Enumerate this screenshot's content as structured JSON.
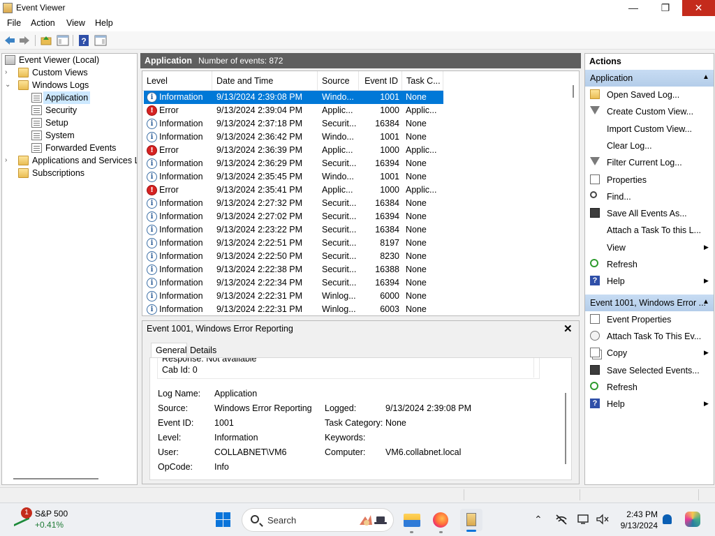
{
  "window": {
    "title": "Event Viewer",
    "controls": {
      "minimize": "—",
      "maximize": "❐",
      "close": "✕"
    }
  },
  "menu": [
    "File",
    "Action",
    "View",
    "Help"
  ],
  "tree": {
    "items": [
      {
        "label": "Event Viewer (Local)",
        "icon": "event-viewer-icon",
        "expander": ""
      },
      {
        "label": "Custom Views",
        "icon": "folder-icon",
        "expander": "›"
      },
      {
        "label": "Windows Logs",
        "icon": "folder-icon",
        "expander": "⌄"
      },
      {
        "label": "Application",
        "icon": "log-icon",
        "expander": ""
      },
      {
        "label": "Security",
        "icon": "log-icon",
        "expander": ""
      },
      {
        "label": "Setup",
        "icon": "log-icon",
        "expander": ""
      },
      {
        "label": "System",
        "icon": "log-icon",
        "expander": ""
      },
      {
        "label": "Forwarded Events",
        "icon": "log-icon",
        "expander": ""
      },
      {
        "label": "Applications and Services Lo",
        "icon": "folder-icon",
        "expander": "›"
      },
      {
        "label": "Subscriptions",
        "icon": "folder-icon",
        "expander": ""
      }
    ],
    "selected": "Application"
  },
  "center": {
    "title": "Application",
    "event_count": "Number of events: 872",
    "columns": [
      "Level",
      "Date and Time",
      "Source",
      "Event ID",
      "Task C..."
    ],
    "rows": [
      {
        "level": "Information",
        "datetime": "9/13/2024 2:39:08 PM",
        "source": "Windo...",
        "event_id": "1001",
        "task": "None"
      },
      {
        "level": "Error",
        "datetime": "9/13/2024 2:39:04 PM",
        "source": "Applic...",
        "event_id": "1000",
        "task": "Applic..."
      },
      {
        "level": "Information",
        "datetime": "9/13/2024 2:37:18 PM",
        "source": "Securit...",
        "event_id": "16384",
        "task": "None"
      },
      {
        "level": "Information",
        "datetime": "9/13/2024 2:36:42 PM",
        "source": "Windo...",
        "event_id": "1001",
        "task": "None"
      },
      {
        "level": "Error",
        "datetime": "9/13/2024 2:36:39 PM",
        "source": "Applic...",
        "event_id": "1000",
        "task": "Applic..."
      },
      {
        "level": "Information",
        "datetime": "9/13/2024 2:36:29 PM",
        "source": "Securit...",
        "event_id": "16394",
        "task": "None"
      },
      {
        "level": "Information",
        "datetime": "9/13/2024 2:35:45 PM",
        "source": "Windo...",
        "event_id": "1001",
        "task": "None"
      },
      {
        "level": "Error",
        "datetime": "9/13/2024 2:35:41 PM",
        "source": "Applic...",
        "event_id": "1000",
        "task": "Applic..."
      },
      {
        "level": "Information",
        "datetime": "9/13/2024 2:27:32 PM",
        "source": "Securit...",
        "event_id": "16384",
        "task": "None"
      },
      {
        "level": "Information",
        "datetime": "9/13/2024 2:27:02 PM",
        "source": "Securit...",
        "event_id": "16394",
        "task": "None"
      },
      {
        "level": "Information",
        "datetime": "9/13/2024 2:23:22 PM",
        "source": "Securit...",
        "event_id": "16384",
        "task": "None"
      },
      {
        "level": "Information",
        "datetime": "9/13/2024 2:22:51 PM",
        "source": "Securit...",
        "event_id": "8197",
        "task": "None"
      },
      {
        "level": "Information",
        "datetime": "9/13/2024 2:22:50 PM",
        "source": "Securit...",
        "event_id": "8230",
        "task": "None"
      },
      {
        "level": "Information",
        "datetime": "9/13/2024 2:22:38 PM",
        "source": "Securit...",
        "event_id": "16388",
        "task": "None"
      },
      {
        "level": "Information",
        "datetime": "9/13/2024 2:22:34 PM",
        "source": "Securit...",
        "event_id": "16394",
        "task": "None"
      },
      {
        "level": "Information",
        "datetime": "9/13/2024 2:22:31 PM",
        "source": "Winlog...",
        "event_id": "6000",
        "task": "None"
      },
      {
        "level": "Information",
        "datetime": "9/13/2024 2:22:31 PM",
        "source": "Winlog...",
        "event_id": "6003",
        "task": "None"
      }
    ],
    "selected_row": 0
  },
  "detail": {
    "title": "Event 1001, Windows Error Reporting",
    "close": "✕",
    "tabs": [
      "General",
      "Details"
    ],
    "active_tab": "General",
    "description": [
      "Response: Not available",
      "Cab Id: 0"
    ],
    "fields": {
      "log_name_label": "Log Name:",
      "log_name": "Application",
      "source_label": "Source:",
      "source": "Windows Error Reporting",
      "logged_label": "Logged:",
      "logged": "9/13/2024 2:39:08 PM",
      "event_id_label": "Event ID:",
      "event_id": "1001",
      "task_category_label": "Task Category:",
      "task_category": "None",
      "level_label": "Level:",
      "level": "Information",
      "keywords_label": "Keywords:",
      "keywords": "",
      "user_label": "User:",
      "user": "COLLABNET\\VM6",
      "computer_label": "Computer:",
      "computer": "VM6.collabnet.local",
      "opcode_label": "OpCode:",
      "opcode": "Info"
    }
  },
  "actions": {
    "title": "Actions",
    "section1": {
      "label": "Application",
      "items": [
        {
          "label": "Open Saved Log...",
          "icon": "open-folder-icon",
          "submenu": false
        },
        {
          "label": "Create Custom View...",
          "icon": "filter-icon",
          "submenu": false
        },
        {
          "label": "Import Custom View...",
          "icon": "",
          "submenu": false
        },
        {
          "label": "Clear Log...",
          "icon": "",
          "submenu": false
        },
        {
          "label": "Filter Current Log...",
          "icon": "filter-icon",
          "submenu": false
        },
        {
          "label": "Properties",
          "icon": "properties-icon",
          "submenu": false
        },
        {
          "label": "Find...",
          "icon": "find-icon",
          "submenu": false
        },
        {
          "label": "Save All Events As...",
          "icon": "save-icon",
          "submenu": false
        },
        {
          "label": "Attach a Task To this L...",
          "icon": "",
          "submenu": false
        },
        {
          "label": "View",
          "icon": "",
          "submenu": true
        },
        {
          "label": "Refresh",
          "icon": "refresh-icon",
          "submenu": false
        },
        {
          "label": "Help",
          "icon": "help-icon",
          "submenu": true
        }
      ]
    },
    "section2": {
      "label": "Event 1001, Windows Error ...",
      "items": [
        {
          "label": "Event Properties",
          "icon": "properties-icon",
          "submenu": false
        },
        {
          "label": "Attach Task To This Ev...",
          "icon": "task-icon",
          "submenu": false
        },
        {
          "label": "Copy",
          "icon": "copy-icon",
          "submenu": true
        },
        {
          "label": "Save Selected Events...",
          "icon": "save-icon",
          "submenu": false
        },
        {
          "label": "Refresh",
          "icon": "refresh-icon",
          "submenu": false
        },
        {
          "label": "Help",
          "icon": "help-icon",
          "submenu": true
        }
      ]
    }
  },
  "taskbar": {
    "stock": {
      "badge": "1",
      "name": "S&P 500",
      "change": "+0.41%"
    },
    "search_placeholder": "Search",
    "clock": {
      "time": "2:43 PM",
      "date": "9/13/2024"
    },
    "tray_icons": [
      "chevron-up-icon",
      "network-icon",
      "display-icon",
      "volume-icon"
    ]
  },
  "colors": {
    "selection": "#0078d7",
    "header_dark": "#5f5f5f",
    "actions_section": "#c7dcf3",
    "error_red": "#d62222"
  }
}
